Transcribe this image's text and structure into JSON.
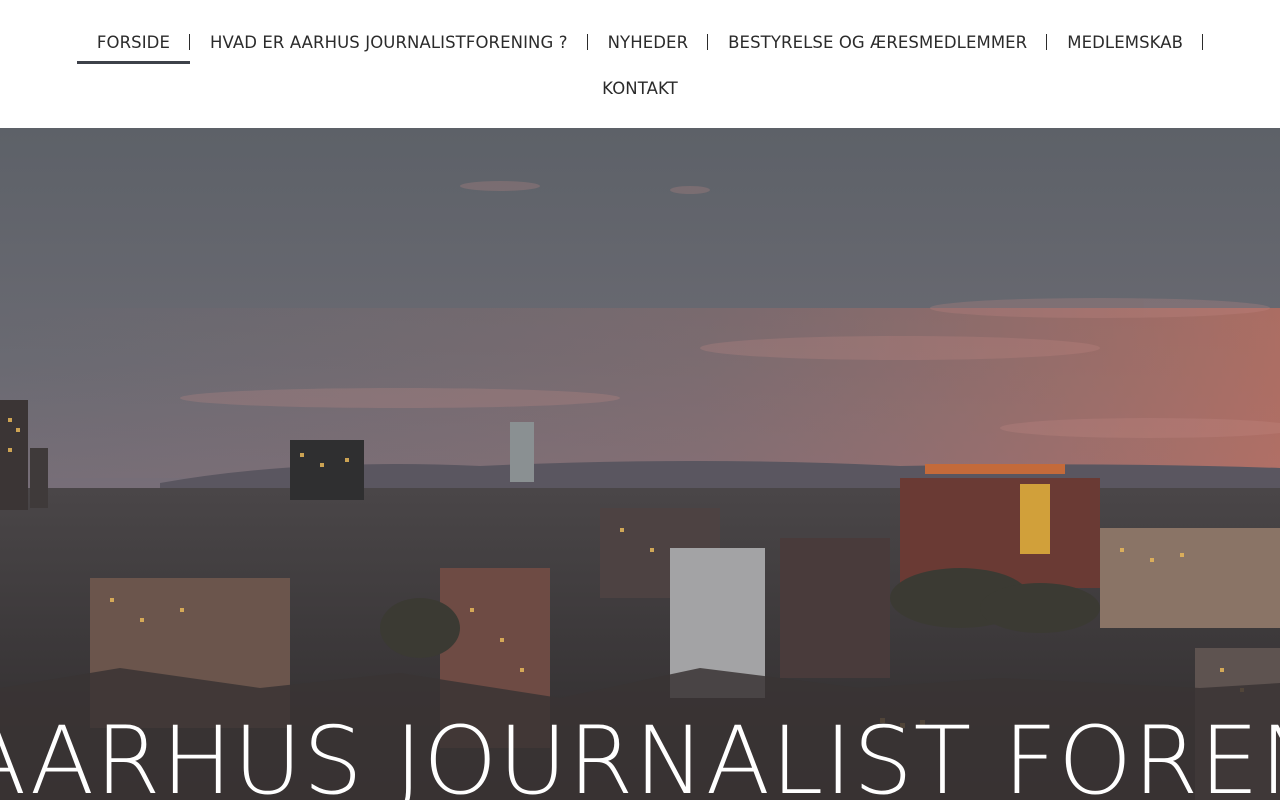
{
  "nav": {
    "row1": [
      {
        "label": "FORSIDE",
        "active": true
      },
      {
        "label": "HVAD ER AARHUS JOURNALISTFORENING ?",
        "active": false
      },
      {
        "label": "NYHEDER",
        "active": false
      },
      {
        "label": "BESTYRELSE OG ÆRESMEDLEMMER",
        "active": false
      },
      {
        "label": "MEDLEMSKAB",
        "active": false
      }
    ],
    "row2": [
      {
        "label": "KONTAKT",
        "active": false
      }
    ]
  },
  "hero": {
    "title": "AARHUS JOURNALIST FORENING",
    "image_alt": "city-skyline-photo"
  },
  "colors": {
    "text": "#2b2b2b",
    "active_underline": "#3d4149",
    "hero_text": "#ffffff"
  }
}
